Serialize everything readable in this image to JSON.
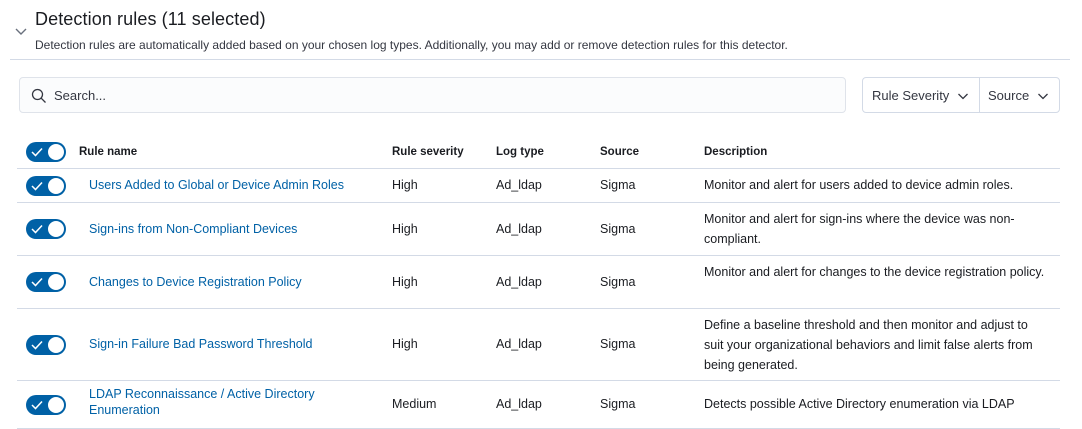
{
  "header": {
    "title": "Detection rules (11 selected)",
    "subtitle": "Detection rules are automatically added based on your chosen log types. Additionally, you may add or remove detection rules for this detector."
  },
  "search": {
    "placeholder": "Search..."
  },
  "filters": {
    "severity_label": "Rule Severity",
    "source_label": "Source"
  },
  "table": {
    "columns": [
      "Rule name",
      "Rule severity",
      "Log type",
      "Source",
      "Description"
    ],
    "rows": [
      {
        "name": "Users Added to Global or Device Admin Roles",
        "severity": "High",
        "log_type": "Ad_ldap",
        "source": "Sigma",
        "description": "Monitor and alert for users added to device admin roles.",
        "enabled": true
      },
      {
        "name": "Sign-ins from Non-Compliant Devices",
        "severity": "High",
        "log_type": "Ad_ldap",
        "source": "Sigma",
        "description": "Monitor and alert for sign-ins where the device was non-compliant.",
        "enabled": true
      },
      {
        "name": "Changes to Device Registration Policy",
        "severity": "High",
        "log_type": "Ad_ldap",
        "source": "Sigma",
        "description": "Monitor and alert for changes to the device registration policy.",
        "enabled": true
      },
      {
        "name": "Sign-in Failure Bad Password Threshold",
        "severity": "High",
        "log_type": "Ad_ldap",
        "source": "Sigma",
        "description": "Define a baseline threshold and then monitor and adjust to suit your organizational behaviors and limit false alerts from being generated.",
        "enabled": true
      },
      {
        "name": "LDAP Reconnaissance / Active Directory Enumeration",
        "severity": "Medium",
        "log_type": "Ad_ldap",
        "source": "Sigma",
        "description": "Detects possible Active Directory enumeration via LDAP",
        "enabled": true
      }
    ]
  },
  "colors": {
    "accent": "#0061a6",
    "border": "#d3dae6",
    "text": "#343741"
  },
  "icons": {
    "collapse": "chevron-down-icon",
    "search": "search-icon",
    "dropdown": "chevron-down-icon",
    "toggle_on": "check-icon"
  }
}
